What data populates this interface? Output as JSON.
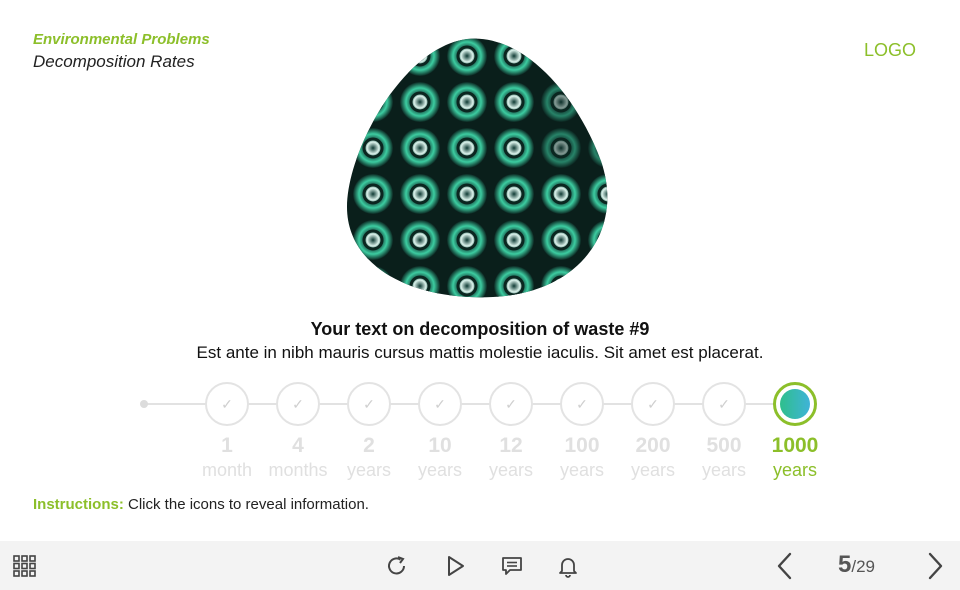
{
  "header": {
    "title": "Environmental Problems",
    "subtitle": "Decomposition Rates",
    "logo": "LOGO"
  },
  "content": {
    "heading": "Your text on decomposition of waste #9",
    "body": "Est ante in nibh mauris cursus mattis molestie iaculis. Sit amet est placerat."
  },
  "timeline": {
    "steps": [
      {
        "num": "1",
        "unit": "month",
        "state": "visited"
      },
      {
        "num": "4",
        "unit": "months",
        "state": "visited"
      },
      {
        "num": "2",
        "unit": "years",
        "state": "visited"
      },
      {
        "num": "10",
        "unit": "years",
        "state": "visited"
      },
      {
        "num": "12",
        "unit": "years",
        "state": "visited"
      },
      {
        "num": "100",
        "unit": "years",
        "state": "visited"
      },
      {
        "num": "200",
        "unit": "years",
        "state": "visited"
      },
      {
        "num": "500",
        "unit": "years",
        "state": "visited"
      },
      {
        "num": "1000",
        "unit": "years",
        "state": "active"
      }
    ]
  },
  "instructions": {
    "label": "Instructions:",
    "text": "Click the icons to reveal information."
  },
  "toolbar": {
    "current_page": "5",
    "total_pages": "/29",
    "icons": [
      "grid-menu-icon",
      "replay-icon",
      "play-icon",
      "comment-icon",
      "bell-icon",
      "prev-arrow-icon",
      "next-arrow-icon"
    ]
  },
  "colors": {
    "accent": "#8cbf2a",
    "inactive": "#e0e0e0",
    "toolbar_bg": "#f3f3f3"
  }
}
